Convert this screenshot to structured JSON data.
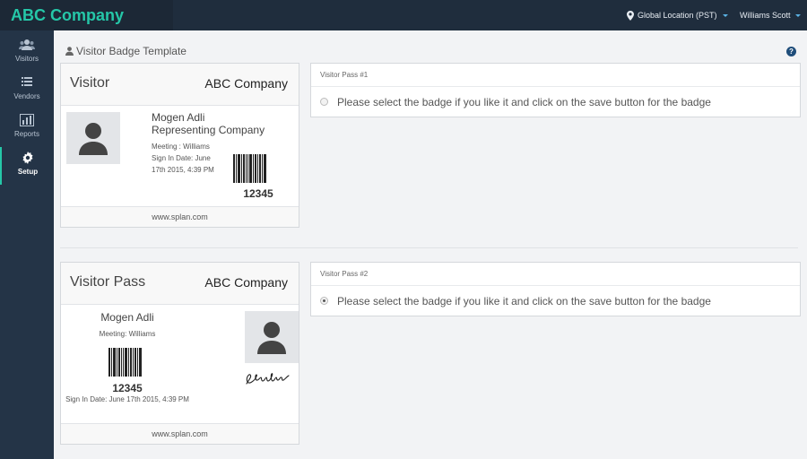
{
  "header": {
    "brand": "ABC Company",
    "location": "Global Location (PST)",
    "user": "Williams Scott"
  },
  "sidebar": {
    "items": [
      {
        "label": "Visitors",
        "icon": "users-icon"
      },
      {
        "label": "Vendors",
        "icon": "list-icon"
      },
      {
        "label": "Reports",
        "icon": "bar-chart-icon"
      },
      {
        "label": "Setup",
        "icon": "gear-icon",
        "active": true
      }
    ]
  },
  "page": {
    "title": "Visitor Badge Template"
  },
  "badge1": {
    "title": "Visitor",
    "company": "ABC Company",
    "name": "Mogen Adli",
    "representing": "Representing Company",
    "meeting": "Meeting : Williams",
    "signin": "Sign In Date: June 17th 2015, 4:39 PM",
    "barcode_number": "12345",
    "footer": "www.splan.com"
  },
  "badge2": {
    "title": "Visitor Pass",
    "company": "ABC Company",
    "name": "Mogen Adli",
    "meeting": "Meeting: Williams",
    "barcode_number": "12345",
    "signin": "Sign In Date: June 17th 2015, 4:39 PM",
    "footer": "www.splan.com"
  },
  "panel1": {
    "title": "Visitor Pass #1",
    "option_text": "Please select the badge if you like it and click on the save button for the badge",
    "selected": false
  },
  "panel2": {
    "title": "Visitor Pass #2",
    "option_text": "Please select the badge if you like it and click on the save button for the badge",
    "selected": true
  },
  "colors": {
    "brand": "#25c7a8",
    "topbar": "#1f2d3d",
    "sidebar": "#243447",
    "help": "#1f4d7a"
  }
}
